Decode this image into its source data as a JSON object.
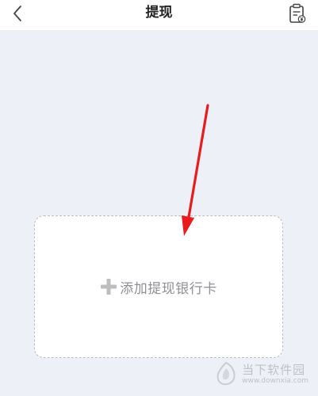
{
  "header": {
    "title": "提现",
    "back_icon": "chevron-left-icon",
    "records_icon": "receipt-icon"
  },
  "main": {
    "add_card_label": "添加提现银行卡",
    "add_icon": "plus-icon"
  },
  "annotation": {
    "arrow_color": "#e81c1c"
  },
  "watermark": {
    "name": "当下软件园",
    "url": "www.downxia.com"
  },
  "colors": {
    "background": "#eef0f8",
    "card": "#ffffff",
    "label": "#8f8f97"
  }
}
